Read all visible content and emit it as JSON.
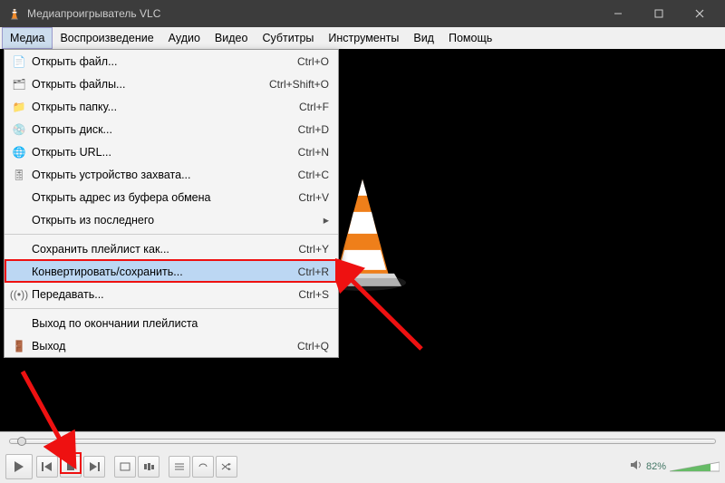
{
  "title": "Медиапроигрыватель VLC",
  "menubar": [
    "Медиа",
    "Воспроизведение",
    "Аудио",
    "Видео",
    "Субтитры",
    "Инструменты",
    "Вид",
    "Помощь"
  ],
  "dropdown": {
    "groups": [
      [
        {
          "icon": "📄",
          "label": "Открыть файл...",
          "shortcut": "Ctrl+O"
        },
        {
          "icon": "🗂",
          "label": "Открыть файлы...",
          "shortcut": "Ctrl+Shift+O"
        },
        {
          "icon": "📁",
          "label": "Открыть папку...",
          "shortcut": "Ctrl+F"
        },
        {
          "icon": "💿",
          "label": "Открыть диск...",
          "shortcut": "Ctrl+D"
        },
        {
          "icon": "🌐",
          "label": "Открыть URL...",
          "shortcut": "Ctrl+N"
        },
        {
          "icon": "🎚",
          "label": "Открыть устройство захвата...",
          "shortcut": "Ctrl+C"
        },
        {
          "icon": "",
          "label": "Открыть адрес из буфера обмена",
          "shortcut": "Ctrl+V"
        },
        {
          "icon": "",
          "label": "Открыть из последнего",
          "shortcut": "",
          "submenu": true
        }
      ],
      [
        {
          "icon": "",
          "label": "Сохранить плейлист как...",
          "shortcut": "Ctrl+Y"
        },
        {
          "icon": "",
          "label": "Конвертировать/сохранить...",
          "shortcut": "Ctrl+R",
          "highlight": true
        },
        {
          "icon": "((•))",
          "label": "Передавать...",
          "shortcut": "Ctrl+S"
        }
      ],
      [
        {
          "icon": "",
          "label": "Выход по окончании плейлиста",
          "shortcut": ""
        },
        {
          "icon": "🚪",
          "label": "Выход",
          "shortcut": "Ctrl+Q"
        }
      ]
    ]
  },
  "volume": {
    "pct": "82%"
  },
  "accent": "#e11",
  "highlight_bg": "#bcd7f3"
}
